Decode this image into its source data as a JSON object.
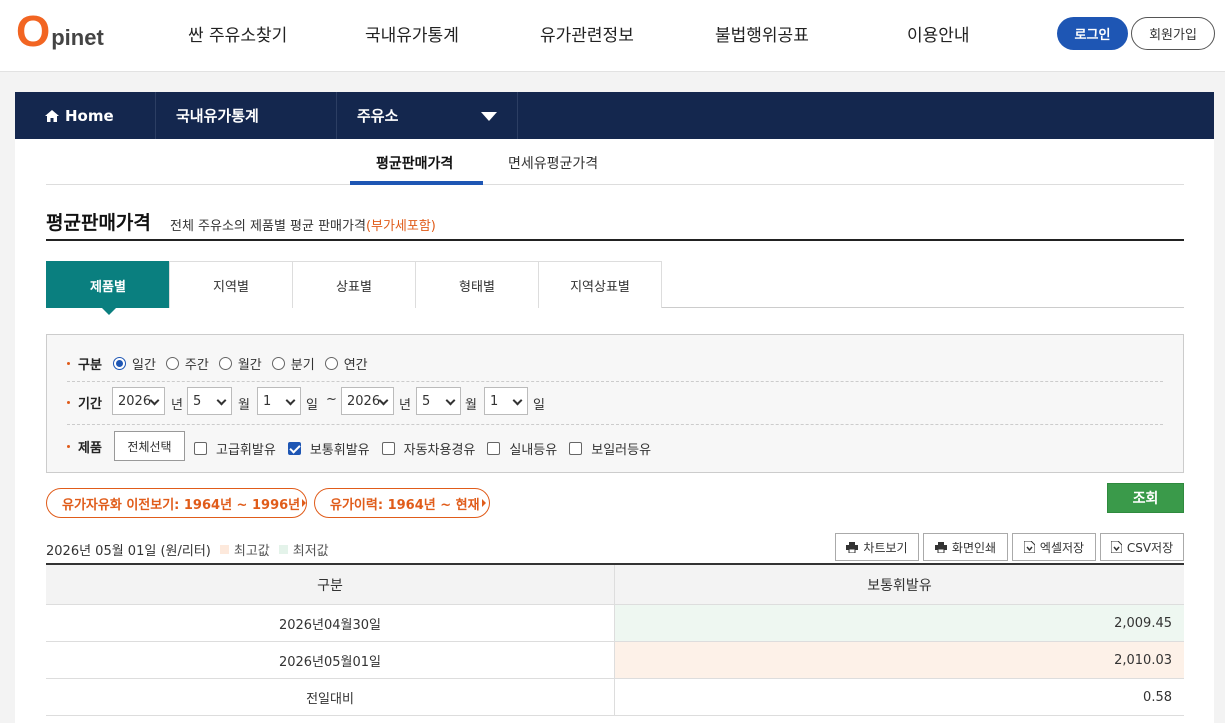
{
  "header": {
    "logo_o": "O",
    "logo_rest": "pinet",
    "nav": [
      "싼 주유소찾기",
      "국내유가통계",
      "유가관련정보",
      "불법행위공표",
      "이용안내"
    ],
    "login": "로그인",
    "join": "회원가입"
  },
  "lnb": {
    "home": "Home",
    "level1": "국내유가통계",
    "level2": "주유소"
  },
  "subtabs": [
    "평균판매가격",
    "면세유평균가격"
  ],
  "title": {
    "main": "평균판매가격",
    "desc": "전체 주유소의 제품별 평균 판매가격",
    "vat": "(부가세포함)"
  },
  "tabs": [
    "제품별",
    "지역별",
    "상표별",
    "형태별",
    "지역상표별"
  ],
  "search": {
    "type_label": "구분",
    "type_options": [
      "일간",
      "주간",
      "월간",
      "분기",
      "연간"
    ],
    "type_selected": 0,
    "period_label": "기간",
    "from": {
      "year": "2026",
      "month": "5",
      "day": "1"
    },
    "to": {
      "year": "2026",
      "month": "5",
      "day": "1"
    },
    "unit_year": "년",
    "unit_month": "월",
    "unit_day": "일",
    "tilde": "~",
    "product_label": "제품",
    "select_all": "전체선택",
    "products": [
      {
        "label": "고급휘발유",
        "checked": false
      },
      {
        "label": "보통휘발유",
        "checked": true
      },
      {
        "label": "자동차용경유",
        "checked": false
      },
      {
        "label": "실내등유",
        "checked": false
      },
      {
        "label": "보일러등유",
        "checked": false
      }
    ]
  },
  "links": {
    "history1": "유가자유화 이전보기: 1964년 ~ 1996년",
    "history2": "유가이력: 1964년 ~ 현재"
  },
  "query": "조회",
  "result": {
    "date_line": "2026년 05월 01일 (원/리터)",
    "legend_max": "최고값",
    "legend_min": "최저값",
    "legend_max_color": "#fde9dc",
    "legend_min_color": "#e4f3ea",
    "tools": [
      "차트보기",
      "화면인쇄",
      "엑셀저장",
      "CSV저장"
    ],
    "columns": [
      "구분",
      "보통휘발유"
    ],
    "rows": [
      {
        "label": "2026년04월30일",
        "value": "2,009.45",
        "mark": "min"
      },
      {
        "label": "2026년05월01일",
        "value": "2,010.03",
        "mark": "max"
      },
      {
        "label": "전일대비",
        "value": "0.58",
        "mark": "none"
      }
    ]
  },
  "colors": {
    "navy": "#14274e",
    "teal": "#0a7f7f",
    "blue": "#1e56b4",
    "orange": "#e05c1a",
    "green": "#3a9a4a"
  }
}
